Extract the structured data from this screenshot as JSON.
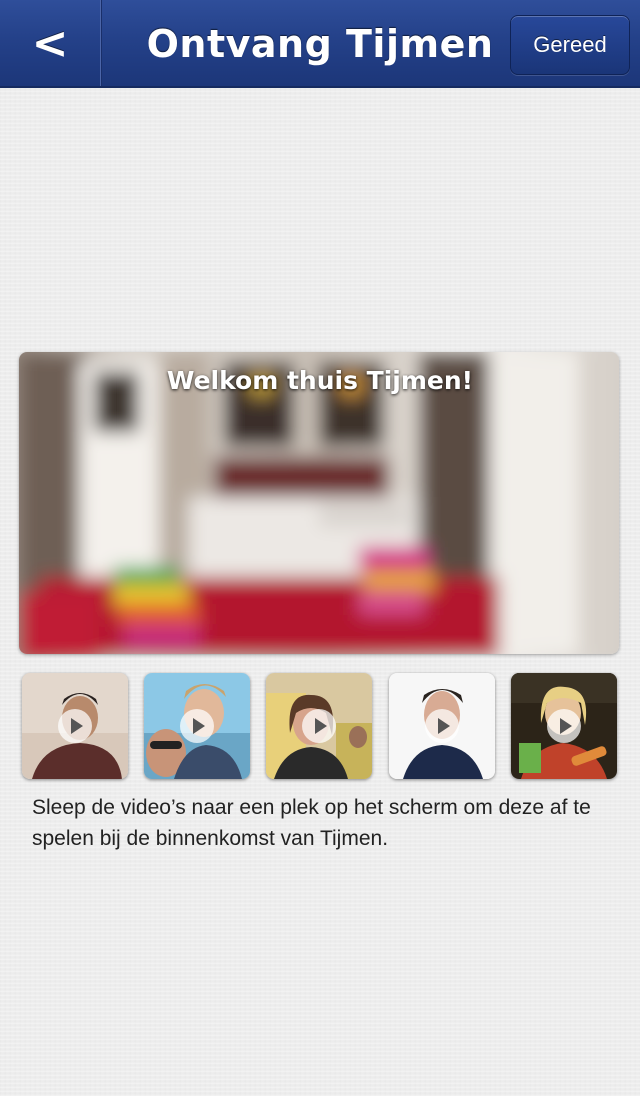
{
  "navbar": {
    "back_label": "<",
    "title": "Ontvang Tijmen",
    "done_label": "Gereed"
  },
  "hero": {
    "caption": "Welkom thuis Tijmen!"
  },
  "videos": [
    {
      "icon": "play-icon"
    },
    {
      "icon": "play-icon"
    },
    {
      "icon": "play-icon"
    },
    {
      "icon": "play-icon"
    },
    {
      "icon": "play-icon"
    }
  ],
  "instructions": "Sleep de video’s naar een plek op het scherm om deze af te spelen bij de binnenkomst van Tijmen.",
  "colors": {
    "navbar": "#244189",
    "background": "#ececec",
    "text": "#222222"
  }
}
